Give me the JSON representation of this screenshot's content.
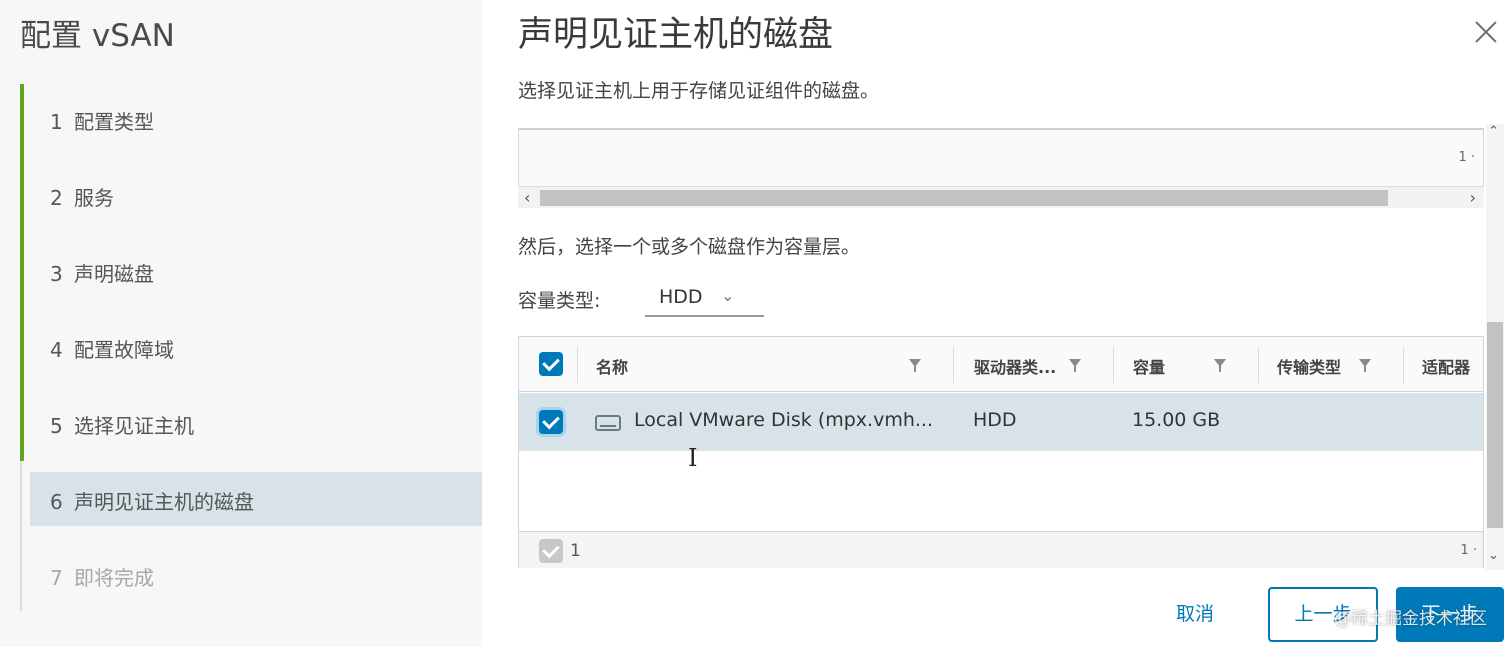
{
  "wizard": {
    "title": "配置 vSAN",
    "steps": [
      {
        "num": "1",
        "label": "配置类型"
      },
      {
        "num": "2",
        "label": "服务"
      },
      {
        "num": "3",
        "label": "声明磁盘"
      },
      {
        "num": "4",
        "label": "配置故障域"
      },
      {
        "num": "5",
        "label": "选择见证主机"
      },
      {
        "num": "6",
        "label": "声明见证主机的磁盘"
      },
      {
        "num": "7",
        "label": "即将完成"
      }
    ],
    "active_step": 6
  },
  "dialog": {
    "title": "声明见证主机的磁盘",
    "description": "选择见证主机上用于存储见证组件的磁盘。",
    "instruction": "然后，选择一个或多个磁盘作为容量层。",
    "capacity_type_label": "容量类型:",
    "capacity_type_value": "HDD"
  },
  "cache_grid": {
    "count": "1 ·"
  },
  "disk_grid": {
    "columns": [
      "名称",
      "驱动器类...",
      "容量",
      "传输类型",
      "适配器"
    ],
    "rows": [
      {
        "name": "Local VMware Disk (mpx.vmh...",
        "drive_type": "HDD",
        "capacity": "15.00 GB",
        "transport": "",
        "adapter": "",
        "selected": true
      }
    ],
    "footer_count": "1",
    "footer_count_right": "1 ·"
  },
  "buttons": {
    "cancel": "取消",
    "back": "上一步",
    "next": "下一步"
  },
  "watermark": "@稀土掘金技术社区",
  "colors": {
    "accent": "#0079b8",
    "progress": "#62a420",
    "active_step_bg": "#d8e3e9"
  }
}
